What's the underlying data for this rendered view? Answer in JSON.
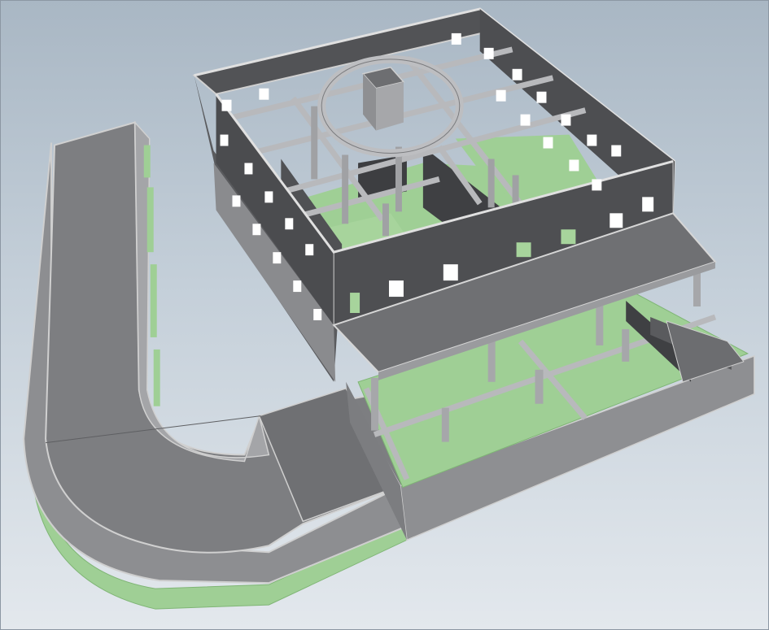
{
  "viewport": {
    "kind": "3d-model-viewport",
    "subject": "shaded-building-model",
    "background_top": "#a9b7c4",
    "background_bottom": "#e3e8ed"
  },
  "palette": {
    "wall_dark": "#4e4f52",
    "wall_mid": "#707174",
    "wall_light": "#9a9b9e",
    "edge": "#d8d8d8",
    "floor_green": "#9fcf95",
    "floor_green_dark": "#7fb575",
    "roof": "#6f7073"
  }
}
